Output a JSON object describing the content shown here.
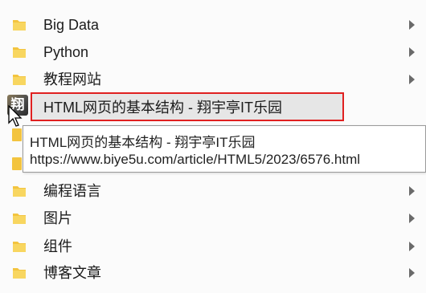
{
  "menu": {
    "items": [
      {
        "label": "Big Data",
        "icon": "folder-icon",
        "has_submenu": true
      },
      {
        "label": "Python",
        "icon": "folder-icon",
        "has_submenu": true
      },
      {
        "label": "教程网站",
        "icon": "folder-icon",
        "has_submenu": true
      },
      {
        "label": "HTML网页的基本结构 - 翔宇亭IT乐园",
        "icon": "site-favicon-icon",
        "has_submenu": false,
        "highlighted": true
      },
      {
        "label": "编程语言",
        "icon": "folder-icon",
        "has_submenu": true
      },
      {
        "label": "图片",
        "icon": "folder-icon",
        "has_submenu": true
      },
      {
        "label": "组件",
        "icon": "folder-icon",
        "has_submenu": true
      },
      {
        "label": "博客文章",
        "icon": "folder-icon",
        "has_submenu": true
      }
    ]
  },
  "tooltip": {
    "title": "HTML网页的基本结构 - 翔宇亭IT乐园",
    "url": "https://www.biye5u.com/article/HTML5/2023/6576.html"
  },
  "favicon_glyph": "翔",
  "colors": {
    "folder": "#f3c43f",
    "highlight_border": "#e02020",
    "highlight_bg": "#e6e6e6"
  }
}
